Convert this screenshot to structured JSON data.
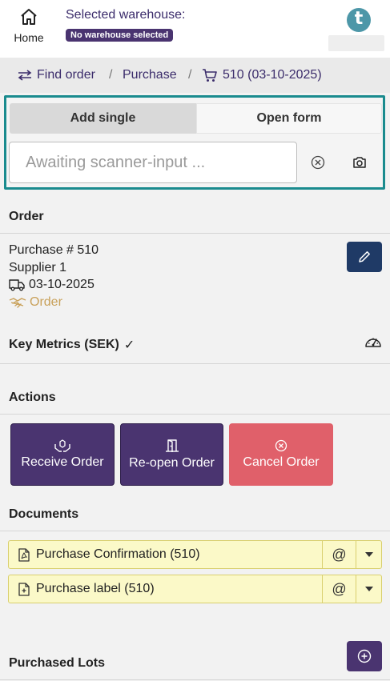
{
  "header": {
    "home_label": "Home",
    "warehouse_title": "Selected warehouse:",
    "warehouse_badge": "No warehouse selected",
    "logo_letter": "t"
  },
  "breadcrumb": {
    "find_order": "Find order",
    "separator": "/",
    "purchase": "Purchase",
    "current": "510 (03-10-2025)"
  },
  "scanner": {
    "tab_add_single": "Add single",
    "tab_open_form": "Open form",
    "placeholder": "Awaiting scanner-input ..."
  },
  "order": {
    "title": "Order",
    "purchase_number": "Purchase # 510",
    "supplier": "Supplier 1",
    "date": "03-10-2025",
    "status": "Order"
  },
  "key_metrics": {
    "title": "Key Metrics (SEK)",
    "check": "✓"
  },
  "actions": {
    "title": "Actions",
    "receive": "Receive Order",
    "reopen": "Re-open Order",
    "cancel": "Cancel Order"
  },
  "documents": {
    "title": "Documents",
    "items": [
      {
        "label": "Purchase Confirmation (510)",
        "at": "@"
      },
      {
        "label": "Purchase label (510)",
        "at": "@"
      }
    ]
  },
  "purchased_lots": {
    "title": "Purchased Lots"
  },
  "colors": {
    "primary_purple": "#4a3470",
    "teal_border": "#1a8b8e",
    "cancel_red": "#e0606a",
    "edit_blue": "#1f3a66",
    "doc_yellow": "#fbf9c8",
    "status_gold": "#c9a15a"
  }
}
